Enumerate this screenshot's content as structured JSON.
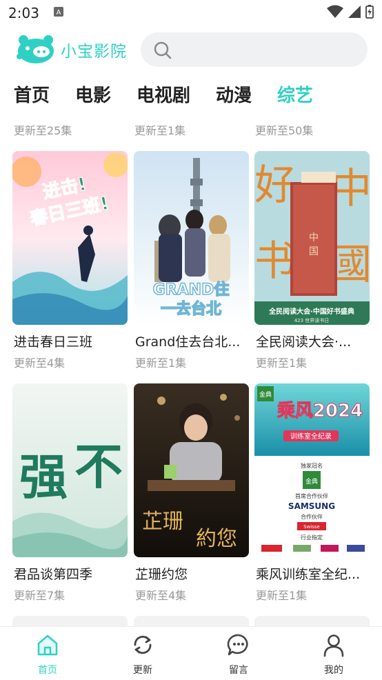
{
  "status_bar": {
    "time": "2:03"
  },
  "app": {
    "name": "小宝影院"
  },
  "search": {
    "placeholder": ""
  },
  "tabs": [
    {
      "label": "首页",
      "active": false
    },
    {
      "label": "电影",
      "active": false
    },
    {
      "label": "电视剧",
      "active": false
    },
    {
      "label": "动漫",
      "active": false
    },
    {
      "label": "综艺",
      "active": true
    }
  ],
  "top_row_updates": [
    "更新至25集",
    "更新至1集",
    "更新至50集"
  ],
  "cards": [
    {
      "title": "进击春日三班",
      "update": "更新至4集",
      "poster_text": "进击！春日三班！"
    },
    {
      "title": "Grand住去台北...",
      "update": "更新至1集",
      "poster_text": "GRAND住去台北"
    },
    {
      "title": "全民阅读大会·...",
      "update": "更新至1集",
      "poster_text": "好 中 书 國",
      "poster_band": "全民阅读大会·中国好书盛典",
      "poster_band_sub": "423 世界读书日"
    },
    {
      "title": "君品谈第四季",
      "update": "更新至7集",
      "poster_text": "强不"
    },
    {
      "title": "芷珊约您",
      "update": "更新至4集",
      "poster_text": "芷珊约您"
    },
    {
      "title": "乘风训练室全纪...",
      "update": "更新至1集",
      "poster_text": "乘风2024",
      "poster_sub": "训练室全纪录",
      "sponsor_lines": [
        "独家冠名",
        "金典",
        "首席合作伙伴",
        "SAMSUNG",
        "合作伙伴",
        "Swisse",
        "行业指定"
      ]
    }
  ],
  "bottom_nav": [
    {
      "label": "首页",
      "icon": "home-icon",
      "active": true
    },
    {
      "label": "更新",
      "icon": "refresh-icon",
      "active": false
    },
    {
      "label": "留言",
      "icon": "message-icon",
      "active": false
    },
    {
      "label": "我的",
      "icon": "user-icon",
      "active": false
    }
  ],
  "colors": {
    "accent": "#2fd0c4",
    "muted_text": "#999999",
    "text": "#222222"
  }
}
